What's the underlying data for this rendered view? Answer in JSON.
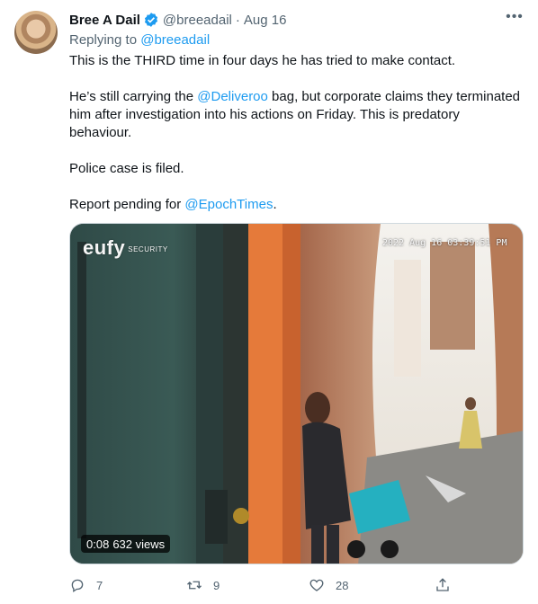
{
  "tweet": {
    "author_name": "Bree A Dail",
    "author_handle": "@breeadail",
    "separator": "·",
    "timestamp": "Aug 16",
    "reply_prefix": "Replying to",
    "reply_handle": "@breeadail",
    "p1": "This is the THIRD time in four days he has tried to make contact.",
    "p2_before": "He’s still carrying the ",
    "p2_mention": "@Deliveroo",
    "p2_after": " bag, but corporate claims they terminated him after investigation into his actions on Friday. This is predatory behaviour.",
    "p3": "Police case is filed.",
    "p4_before": "Report pending for ",
    "p4_mention": "@EpochTimes",
    "p4_after": "."
  },
  "media": {
    "brand": "eufy",
    "brand_sub": "SECURITY",
    "datetime_overlay": "2022 Aug 16 03:39:51 PM",
    "duration": "0:08",
    "views": "632 views"
  },
  "actions": {
    "replies": "7",
    "retweets": "9",
    "likes": "28"
  },
  "colors": {
    "link": "#1d9bf0",
    "secondary_text": "#536471",
    "verified": "#1d9bf0"
  }
}
